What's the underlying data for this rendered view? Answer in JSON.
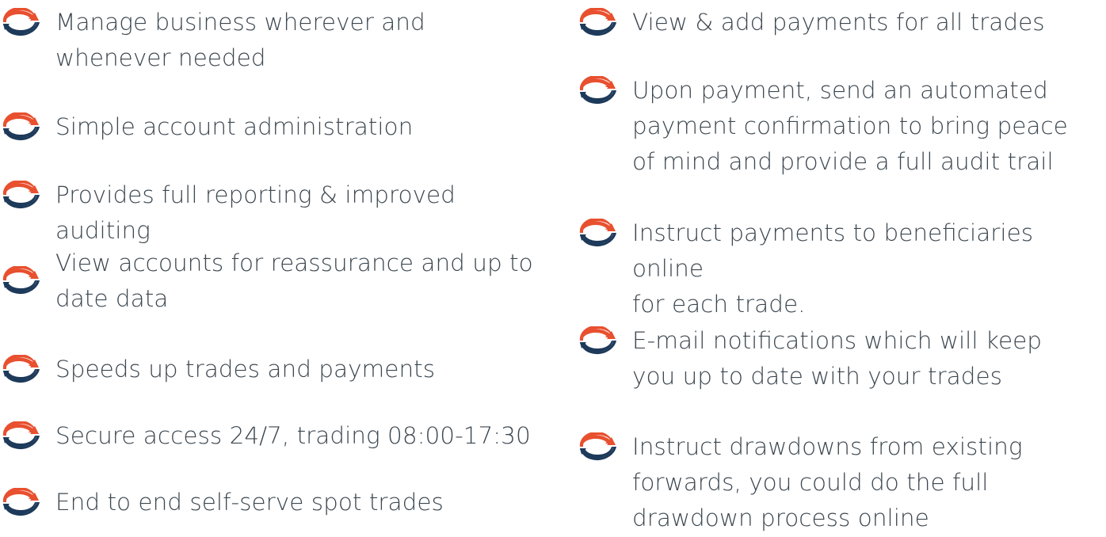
{
  "colors": {
    "accent_orange": "#e8502f",
    "navy": "#1e3a5a",
    "text": "#3c4750"
  },
  "icon": "circular-arrows-icon",
  "left_column": {
    "items": [
      {
        "text": "Manage business wherever and\nwhenever needed"
      },
      {
        "text": "Simple account administration"
      },
      {
        "text": "Provides full reporting & improved auditing"
      },
      {
        "text": "View accounts for reassurance and up to\ndate data"
      },
      {
        "text": "Speeds up trades and payments"
      },
      {
        "text": "Secure access 24/7, trading 08:00-17:30"
      },
      {
        "text": "End to end self-serve spot trades"
      }
    ]
  },
  "right_column": {
    "items": [
      {
        "text": "View & add payments for all trades"
      },
      {
        "text": "Upon payment, send an automated\npayment confirmation to bring peace\nof mind and provide a full audit trail"
      },
      {
        "text": "Instruct payments to beneficiaries online\nfor each trade."
      },
      {
        "text": "E-mail notifications which will keep\nyou up to date with your trades"
      },
      {
        "text": "Instruct drawdowns from existing\nforwards, you could do the full\ndrawdown process online"
      }
    ]
  }
}
